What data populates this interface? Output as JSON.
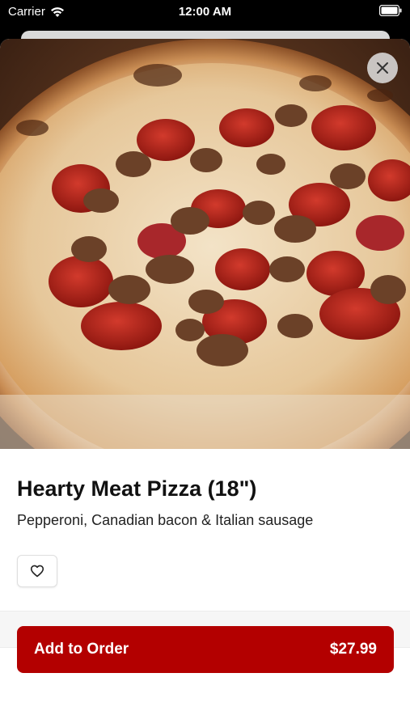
{
  "status_bar": {
    "carrier": "Carrier",
    "time": "12:00 AM"
  },
  "item": {
    "name": "Hearty Meat Pizza (18\")",
    "description": "Pepperoni, Canadian bacon & Italian sausage",
    "image_icon": "pizza-photo"
  },
  "actions": {
    "close_icon": "close-icon",
    "favorite_icon": "heart-icon"
  },
  "footer": {
    "add_label": "Add to Order",
    "price": "$27.99"
  },
  "colors": {
    "accent": "#b30000"
  }
}
